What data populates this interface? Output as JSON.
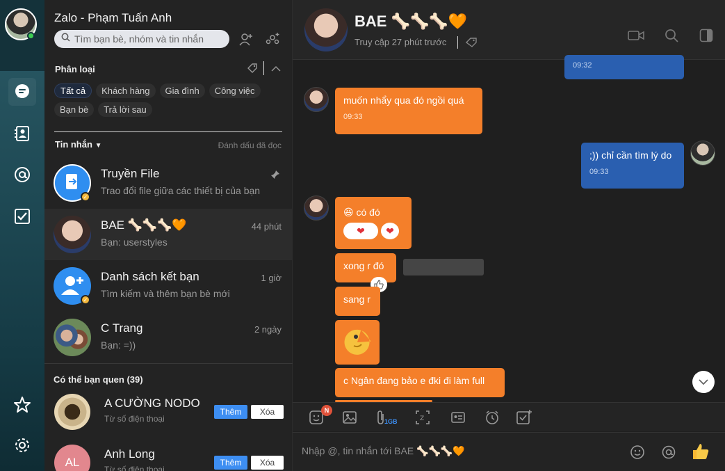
{
  "window": {
    "title": "Zalo - Phạm Tuấn Anh"
  },
  "search": {
    "placeholder": "Tìm bạn bè, nhóm và tin nhắn"
  },
  "filters": {
    "label": "Phân loại",
    "chips": [
      "Tất cả",
      "Khách hàng",
      "Gia đình",
      "Công việc",
      "Bạn bè",
      "Trả lời sau"
    ],
    "active": "Tất cả"
  },
  "list_header": {
    "tab": "Tin nhắn",
    "mark_read": "Đánh dấu đã đọc"
  },
  "conversations": [
    {
      "name": "Truyền File",
      "preview": "Trao đổi file giữa các thiết bị của bạn",
      "time": "",
      "pinned": true
    },
    {
      "name": "BAE 🦴🦴🦴🧡",
      "preview": "Bạn: userstyles",
      "time": "44 phút",
      "selected": true
    },
    {
      "name": "Danh sách kết bạn",
      "preview": "Tìm kiếm và thêm bạn bè mới",
      "time": "1 giờ"
    },
    {
      "name": "C Trang",
      "preview": "Bạn: =))",
      "time": "2 ngày"
    }
  ],
  "suggestions": {
    "title": "Có thể bạn quen (39)",
    "items": [
      {
        "name": "A CƯỜNG NODO",
        "sub": "Từ số điện thoại",
        "add": "Thêm",
        "remove": "Xóa"
      },
      {
        "name": "Anh Long",
        "sub": "Từ số điện thoại",
        "initials": "AL",
        "add": "Thêm",
        "remove": "Xóa"
      }
    ]
  },
  "chat": {
    "name": "BAE 🦴🦴🦴🧡",
    "status": "Truy cập 27 phút trước",
    "messages": [
      {
        "dir": "out",
        "text": "",
        "time": "09:32"
      },
      {
        "dir": "in",
        "text": "muốn nhẩy qua đó ngồi quá",
        "time": "09:33"
      },
      {
        "dir": "out",
        "text": ";)) chỉ cần tìm lý do",
        "time": "09:33"
      },
      {
        "dir": "in",
        "text": "có đó",
        "emoji": "😆"
      },
      {
        "dir": "in",
        "text": "xong r đó"
      },
      {
        "dir": "in",
        "text": "sang r"
      },
      {
        "dir": "in",
        "text": "",
        "sticker": "pacman"
      },
      {
        "dir": "in",
        "text": "c Ngân đang bảo e đki đi làm full"
      }
    ]
  },
  "composer": {
    "placeholder": "Nhập @, tin nhắn tới BAE 🦴🦴🦴🧡",
    "sticker_badge": "N",
    "attach_size": "1GB"
  },
  "colors": {
    "accent": "#3d8ef2",
    "incoming": "#f47f2a",
    "outgoing": "#2a5fb0",
    "online": "#3dcc52"
  }
}
